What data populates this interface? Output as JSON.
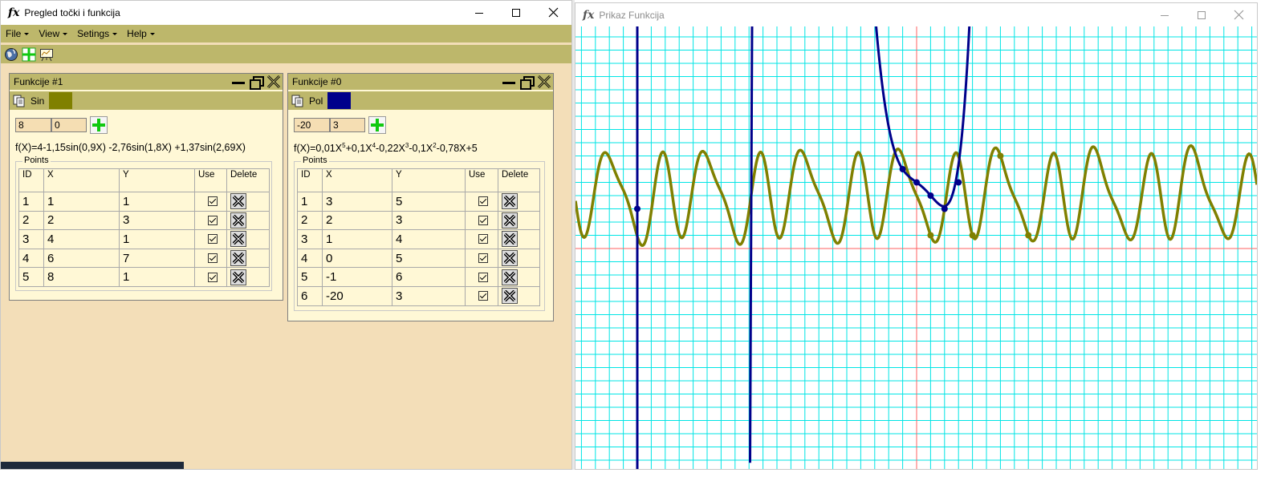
{
  "win1": {
    "title_logo": "fx",
    "title": "Pregled točki i funkcija",
    "menu": [
      {
        "label": "File"
      },
      {
        "label": "View"
      },
      {
        "label": "Setings"
      },
      {
        "label": "Help"
      }
    ]
  },
  "panels": [
    {
      "title": "Funkcije #1",
      "name": "Sin",
      "color": "#808000",
      "input_a": "8",
      "input_b": "0",
      "formula": "f(X)=4-1,15sin(0,9X) -2,76sin(1,8X) +1,37sin(2,69X)",
      "group_label": "Points",
      "columns": [
        "ID",
        "X",
        "Y",
        "Use",
        "Delete"
      ],
      "rows": [
        [
          "1",
          "1",
          "1"
        ],
        [
          "2",
          "2",
          "3"
        ],
        [
          "3",
          "4",
          "1"
        ],
        [
          "4",
          "6",
          "7"
        ],
        [
          "5",
          "8",
          "1"
        ]
      ]
    },
    {
      "title": "Funkcije #0",
      "name": "Pol",
      "color": "#00008b",
      "input_a": "-20",
      "input_b": "3",
      "formula_parts": [
        "f(X)=0,01X",
        "5",
        "+0,1X",
        "4",
        "-0,22X",
        "3",
        "-0,1X",
        "2",
        "-0,78X+5"
      ],
      "group_label": "Points",
      "columns": [
        "ID",
        "X",
        "Y",
        "Use",
        "Delete"
      ],
      "rows": [
        [
          "1",
          "3",
          "5"
        ],
        [
          "2",
          "2",
          "3"
        ],
        [
          "3",
          "1",
          "4"
        ],
        [
          "4",
          "0",
          "5"
        ],
        [
          "5",
          "-1",
          "6"
        ],
        [
          "6",
          "-20",
          "3"
        ]
      ]
    }
  ],
  "win2": {
    "title_logo": "fx",
    "title": "Prikaz Funkcija"
  },
  "colors": {
    "window_bg": "#f3deb8",
    "bar": "#bdb76b",
    "panel_bg": "#fff8d6",
    "grid": "#00e5e5",
    "axis": "#ff6060",
    "sin": "#808000",
    "pol": "#00008b"
  },
  "chart_data": {
    "type": "line",
    "grid": true,
    "series": [
      {
        "name": "Sin",
        "function": "4-1.15*sin(0.9x)-2.76*sin(1.8x)+1.37*sin(2.69x)",
        "points": [
          [
            1,
            1
          ],
          [
            2,
            3
          ],
          [
            4,
            1
          ],
          [
            6,
            7
          ],
          [
            8,
            1
          ]
        ]
      },
      {
        "name": "Pol",
        "function": "0.01x^5+0.1x^4-0.22x^3-0.1x^2-0.78x+5",
        "points": [
          [
            3,
            5
          ],
          [
            2,
            3
          ],
          [
            1,
            4
          ],
          [
            0,
            5
          ],
          [
            -1,
            6
          ],
          [
            -20,
            3
          ]
        ]
      }
    ]
  }
}
